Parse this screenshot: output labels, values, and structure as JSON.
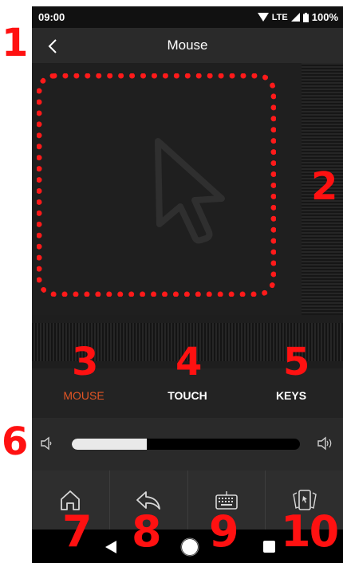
{
  "status_bar": {
    "time": "09:00",
    "network": "LTE",
    "battery": "100%"
  },
  "header": {
    "title": "Mouse"
  },
  "tabs": [
    {
      "label": "MOUSE",
      "active": true
    },
    {
      "label": "TOUCH",
      "active": false
    },
    {
      "label": "KEYS",
      "active": false
    }
  ],
  "volume": {
    "level_fraction": 0.33
  },
  "toolbar": {
    "buttons": [
      "home-icon",
      "return-icon",
      "keyboard-icon",
      "app-switch-icon"
    ]
  },
  "annotations": [
    "1",
    "2",
    "3",
    "4",
    "5",
    "6",
    "7",
    "8",
    "9",
    "10"
  ],
  "colors": {
    "accent": "#e25525",
    "annotation": "#ff1111",
    "background": "#1e1e1e"
  }
}
